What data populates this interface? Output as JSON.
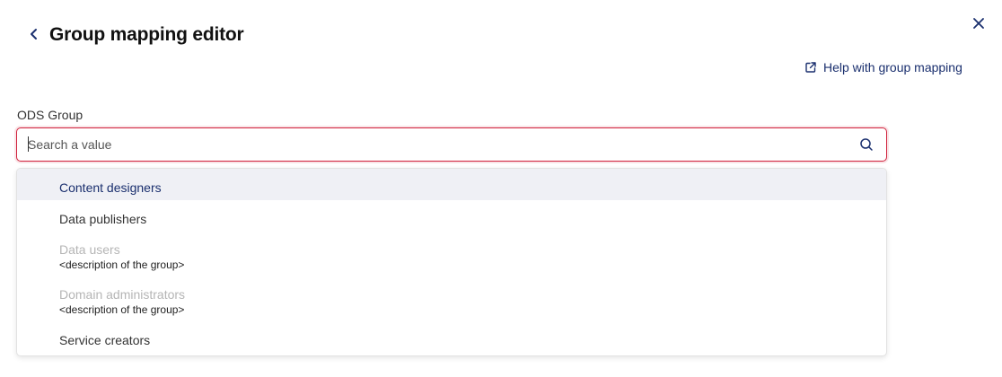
{
  "header": {
    "title": "Group mapping editor",
    "help_link": "Help with group mapping"
  },
  "field": {
    "label": "ODS Group",
    "value": "",
    "placeholder": "Search a value"
  },
  "options": [
    {
      "label": "Content designers",
      "description": "",
      "state": "highlighted"
    },
    {
      "label": "Data publishers",
      "description": "",
      "state": "enabled"
    },
    {
      "label": "Data users",
      "description": "<description of the group>",
      "state": "disabled"
    },
    {
      "label": "Domain administrators",
      "description": "<description of the group>",
      "state": "disabled"
    },
    {
      "label": "Service creators",
      "description": "",
      "state": "enabled"
    }
  ],
  "icons": {
    "back": "chevron-left-icon",
    "close": "close-icon",
    "help": "external-link-icon",
    "search": "search-icon"
  },
  "colors": {
    "accent": "#1a2f6e",
    "error_border": "#d0213c",
    "highlight_bg": "#eff0f5",
    "disabled_text": "#b5b5b5"
  }
}
